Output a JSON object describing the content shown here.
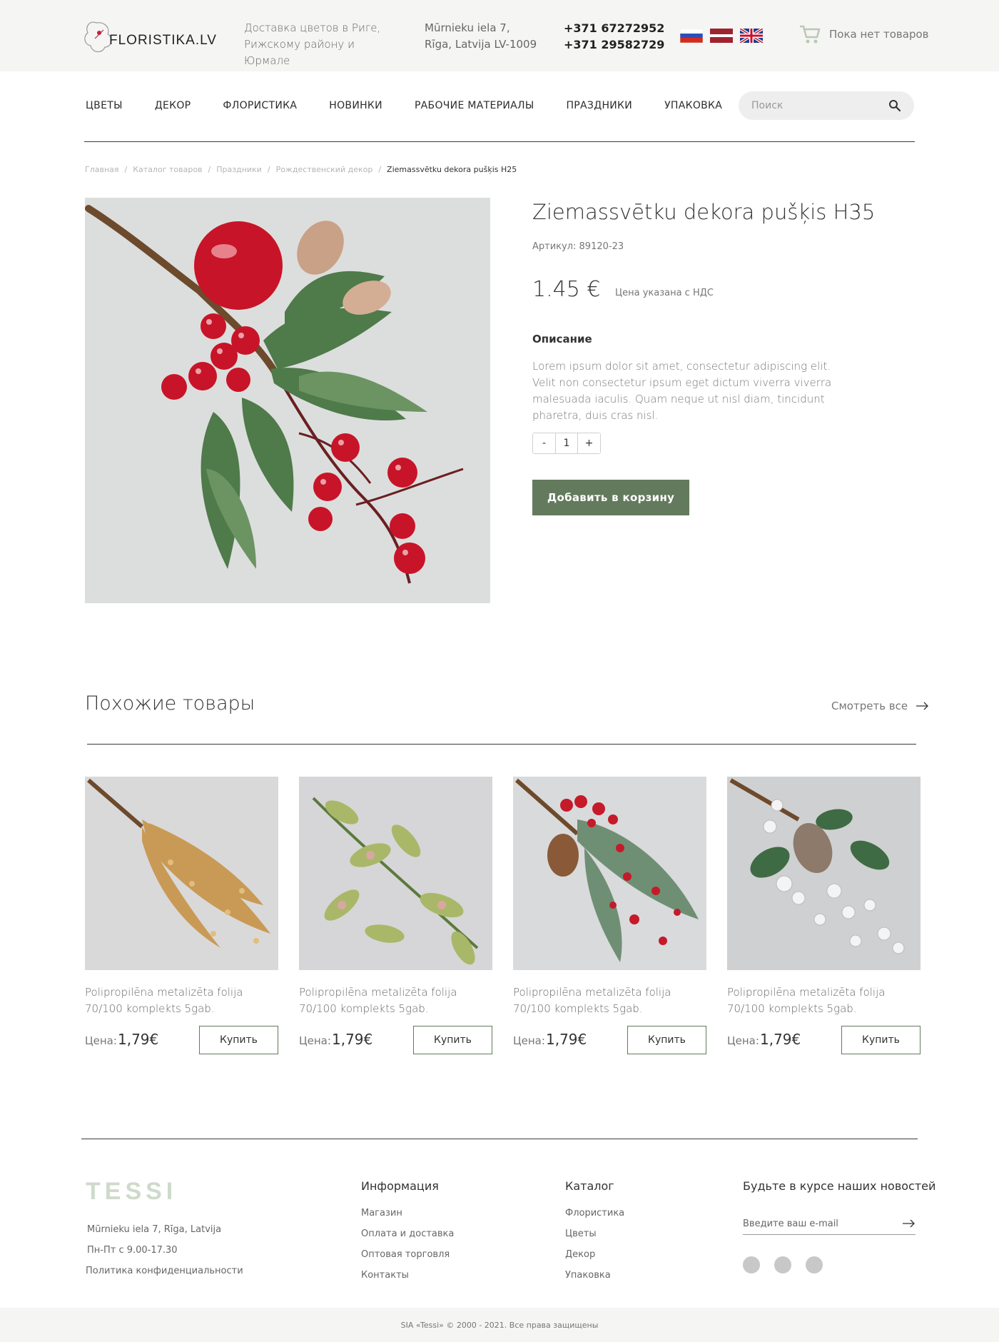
{
  "header": {
    "logo_text": "FLORISTIKA.LV",
    "delivery_line1": "Доставка цветов в Риге,",
    "delivery_line2": "Рижскому району и Юрмале",
    "address_line1": "Mūrnieku iela 7,",
    "address_line2": "Rīga, Latvija  LV-1009",
    "phone1": "+371 67272952",
    "phone2": "+371 29582729",
    "flags": [
      "russia-flag-icon",
      "latvia-flag-icon",
      "uk-flag-icon"
    ],
    "cart_label": "Пока нет товаров"
  },
  "nav": {
    "items": [
      "ЦВЕТЫ",
      "ДЕКОР",
      "ФЛОРИСТИКА",
      "НОВИНКИ",
      "РАБОЧИЕ МАТЕРИАЛЫ",
      "ПРАЗДНИКИ",
      "УПАКОВКА"
    ],
    "search_placeholder": "Поиск"
  },
  "breadcrumb": [
    "Главная",
    "Каталог товаров",
    "Праздники",
    "Рождественский декор",
    "Ziemassvētku dekora pušķis H25"
  ],
  "product": {
    "title": "Ziemassvētku dekora pušķis H35",
    "article": "Артикул: 89120-23",
    "price": "1.45 €",
    "price_note": "Цена указана с НДС",
    "desc_title": "Описание",
    "description": "Lorem ipsum dolor sit amet, consectetur adipiscing elit. Velit non consectetur ipsum eget dictum viverra viverra malesuada iaculis. Quam neque ut nisl diam, tincidunt pharetra, duis cras nisl.",
    "qty_minus": "-",
    "qty_value": "1",
    "qty_plus": "+",
    "add_to_cart": "Добавить в корзину"
  },
  "similar": {
    "title": "Похожие товары",
    "view_all": "Смотреть все",
    "items": [
      {
        "name": "Polipropilēna metalizēta folija 70/100 komplekts 5gab.",
        "price_label": "Цена:",
        "price": "1,79€",
        "buy": "Купить"
      },
      {
        "name": "Polipropilēna metalizēta folija 70/100 komplekts 5gab.",
        "price_label": "Цена:",
        "price": "1,79€",
        "buy": "Купить"
      },
      {
        "name": "Polipropilēna metalizēta folija 70/100 komplekts 5gab.",
        "price_label": "Цена:",
        "price": "1,79€",
        "buy": "Купить"
      },
      {
        "name": "Polipropilēna metalizēta folija 70/100 komplekts 5gab.",
        "price_label": "Цена:",
        "price": "1,79€",
        "buy": "Купить"
      }
    ]
  },
  "footer": {
    "logo": "TESSI",
    "address": "Mūrnieku iela 7, Rīga, Latvija",
    "hours": "Пн-Пт с 9.00-17.30",
    "privacy": "Политика конфиденциальности",
    "info_title": "Информация",
    "info_links": [
      "Магазин",
      "Оплата и доставка",
      "Оптовая торговля",
      "Контакты"
    ],
    "catalog_title": "Каталог",
    "catalog_links": [
      "Флористика",
      "Цветы",
      "Декор",
      "Упаковка"
    ],
    "news_title": "Будьте в курсе наших новостей",
    "email_placeholder": "Введите ваш e-mail",
    "copyright": "SIA «Tessi» © 2000 - 2021. Все права защищены"
  },
  "colors": {
    "accent": "#637a5c",
    "topbar_bg": "#f5f5f4",
    "footer_logo": "#cfdacb"
  }
}
